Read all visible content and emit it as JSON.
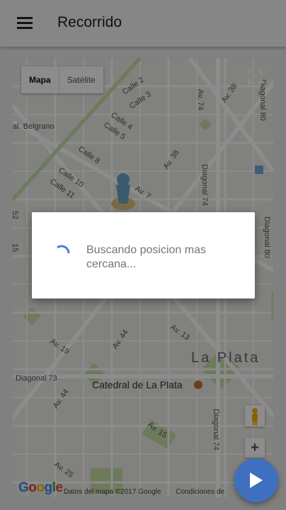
{
  "header": {
    "title": "Recorrido"
  },
  "map": {
    "type_buttons": [
      {
        "label": "Mapa"
      },
      {
        "label": "Satélite"
      }
    ],
    "streets": {
      "belgrano": "al. Belgrano",
      "calle2": "Calle 2",
      "calle3": "Calle 3",
      "calle4": "Calle 4",
      "calle5": "Calle 5",
      "calle8": "Calle 8",
      "calle10": "Calle 10",
      "calle11": "Calle 11",
      "av7": "Av. 7",
      "av38_top": "Av. 38",
      "av38_mid": "Av. 38",
      "av74": "Av. 74",
      "diag80_top": "Diagonal 80",
      "diag74": "Diagonal 74",
      "diag80_right": "Diagonal 80",
      "av44": "Av. 44",
      "av13": "Av. 13",
      "av19": "Av. 19",
      "diag73": "Diagonal 73",
      "av44_low": "Av. 44",
      "av25": "Av. 25",
      "av15": "Av. 15",
      "diag74_low": "Diagonal 74",
      "c52": "52",
      "c15": "15"
    },
    "places": {
      "city": "La Plata",
      "cathedral": "Catedral de La Plata"
    },
    "zoom_in_label": "+",
    "logo": [
      "G",
      "o",
      "o",
      "g",
      "l",
      "e"
    ],
    "attribution": {
      "data": "Datos del mapa ©2017 Google",
      "terms": "Condiciones de"
    }
  },
  "dialog": {
    "message": "Buscando posicion mas cercana..."
  },
  "colors": {
    "fab": "#3f6fbf",
    "spinner": "#4a7fd6"
  }
}
